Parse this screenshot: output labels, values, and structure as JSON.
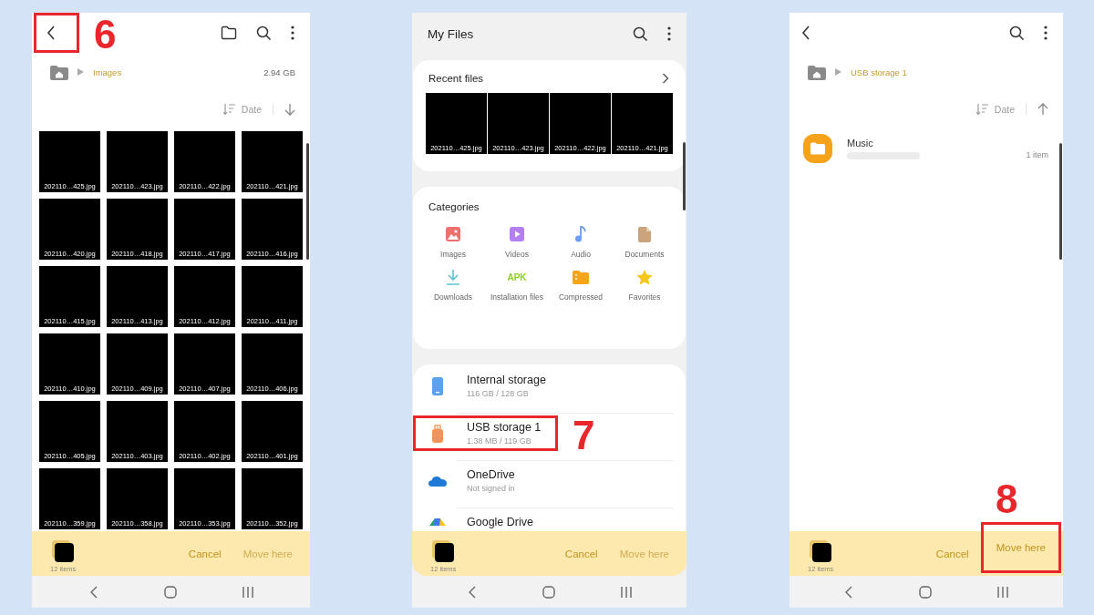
{
  "screens": [
    {
      "kind": "gallery",
      "step": "6",
      "back": {
        "highlighted": true
      },
      "toolbar": [
        {
          "kind": "folder"
        },
        {
          "kind": "search"
        },
        {
          "kind": "more"
        }
      ],
      "breadcrumb": "Images",
      "size": "2.94 GB",
      "sort": {
        "label": "Date",
        "descending": true
      },
      "files": [
        "202110…425.jpg",
        "202110…423.jpg",
        "202110…422.jpg",
        "202110…421.jpg",
        "202110…420.jpg",
        "202110…418.jpg",
        "202110…417.jpg",
        "202110…416.jpg",
        "202110…415.jpg",
        "202110…413.jpg",
        "202110…412.jpg",
        "202110…411.jpg",
        "202110…410.jpg",
        "202110…409.jpg",
        "202110…407.jpg",
        "202110…406.jpg",
        "202110…405.jpg",
        "202110…403.jpg",
        "202110…402.jpg",
        "202110…401.jpg",
        "202110…359.jpg",
        "202110…358.jpg",
        "202110…353.jpg",
        "202110…352.jpg"
      ],
      "footer": {
        "count": "12 items",
        "cancel": "Cancel",
        "move": "Move here",
        "move_enabled": false,
        "move_highlighted": false
      }
    },
    {
      "kind": "home",
      "step": "7",
      "title": "My Files",
      "toolbar": [
        {
          "kind": "search"
        },
        {
          "kind": "more"
        }
      ],
      "recent_title": "Recent files",
      "recent": [
        "202110…425.jpg",
        "202110…423.jpg",
        "202110…422.jpg",
        "202110…421.jpg"
      ],
      "categories_title": "Categories",
      "categories": [
        {
          "kind": "images",
          "label": "Images"
        },
        {
          "kind": "videos",
          "label": "Videos"
        },
        {
          "kind": "audio",
          "label": "Audio"
        },
        {
          "kind": "documents",
          "label": "Documents"
        },
        {
          "kind": "downloads",
          "label": "Downloads"
        },
        {
          "kind": "apk",
          "label": "Installation files",
          "icon_text": "APK"
        },
        {
          "kind": "compressed",
          "label": "Compressed"
        },
        {
          "kind": "favorites",
          "label": "Favorites"
        }
      ],
      "storage": [
        {
          "kind": "phone",
          "name": "Internal storage",
          "detail": "116 GB / 128 GB",
          "highlighted": false
        },
        {
          "kind": "usb",
          "name": "USB storage 1",
          "detail": "1.38 MB / 119 GB",
          "highlighted": true
        },
        {
          "kind": "onedrive",
          "name": "OneDrive",
          "detail": "Not signed in",
          "highlighted": false
        },
        {
          "kind": "gdrive",
          "name": "Google Drive",
          "highlighted": false
        }
      ],
      "footer": {
        "count": "12 items",
        "cancel": "Cancel",
        "move": "Move here",
        "move_enabled": false,
        "move_highlighted": false
      }
    },
    {
      "kind": "folder",
      "step": "8",
      "back": {
        "highlighted": false
      },
      "toolbar": [
        {
          "kind": "search"
        },
        {
          "kind": "more"
        }
      ],
      "breadcrumb": "USB storage 1",
      "sort": {
        "label": "Date",
        "descending": false
      },
      "items": [
        {
          "name": "Music",
          "count": "1 item"
        }
      ],
      "footer": {
        "count": "12 items",
        "cancel": "Cancel",
        "move": "Move here",
        "move_enabled": true,
        "move_highlighted": true
      }
    }
  ]
}
